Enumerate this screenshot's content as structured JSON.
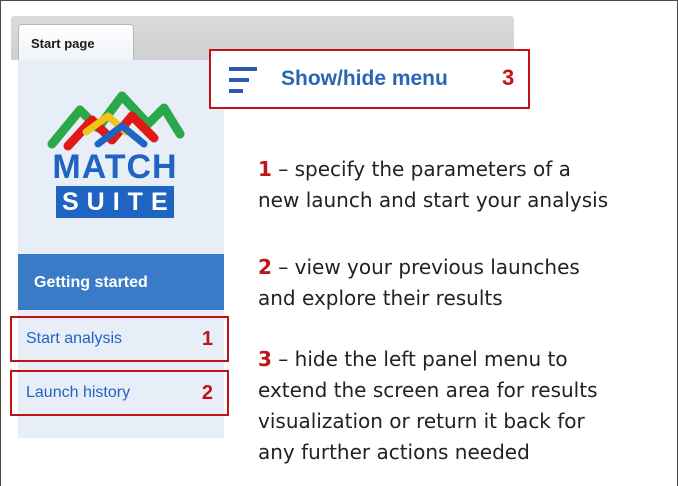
{
  "tab": {
    "label": "Start page"
  },
  "logo": {
    "word1": "MATCH",
    "word2": "SUITE"
  },
  "sidebar": {
    "section": "Getting started",
    "items": [
      {
        "label": "Start analysis",
        "marker": "1"
      },
      {
        "label": "Launch history",
        "marker": "2"
      }
    ]
  },
  "toggle": {
    "label": "Show/hide menu",
    "marker": "3"
  },
  "descriptions": [
    {
      "num": "1",
      "text": " – specify the parameters of a",
      "text2": "new launch and start your analysis"
    },
    {
      "num": "2",
      "text": " – view your previous launches",
      "text2": "and explore their results"
    },
    {
      "num": "3",
      "text": " – hide the left panel menu to",
      "text2": "extend the screen area for results",
      "text3": "visualization or return it back for",
      "text4": "any further actions needed"
    }
  ],
  "colors": {
    "accent": "#1f64c0",
    "highlight": "#c01414",
    "panel": "#e8eef8",
    "section": "#3a7bc8"
  }
}
